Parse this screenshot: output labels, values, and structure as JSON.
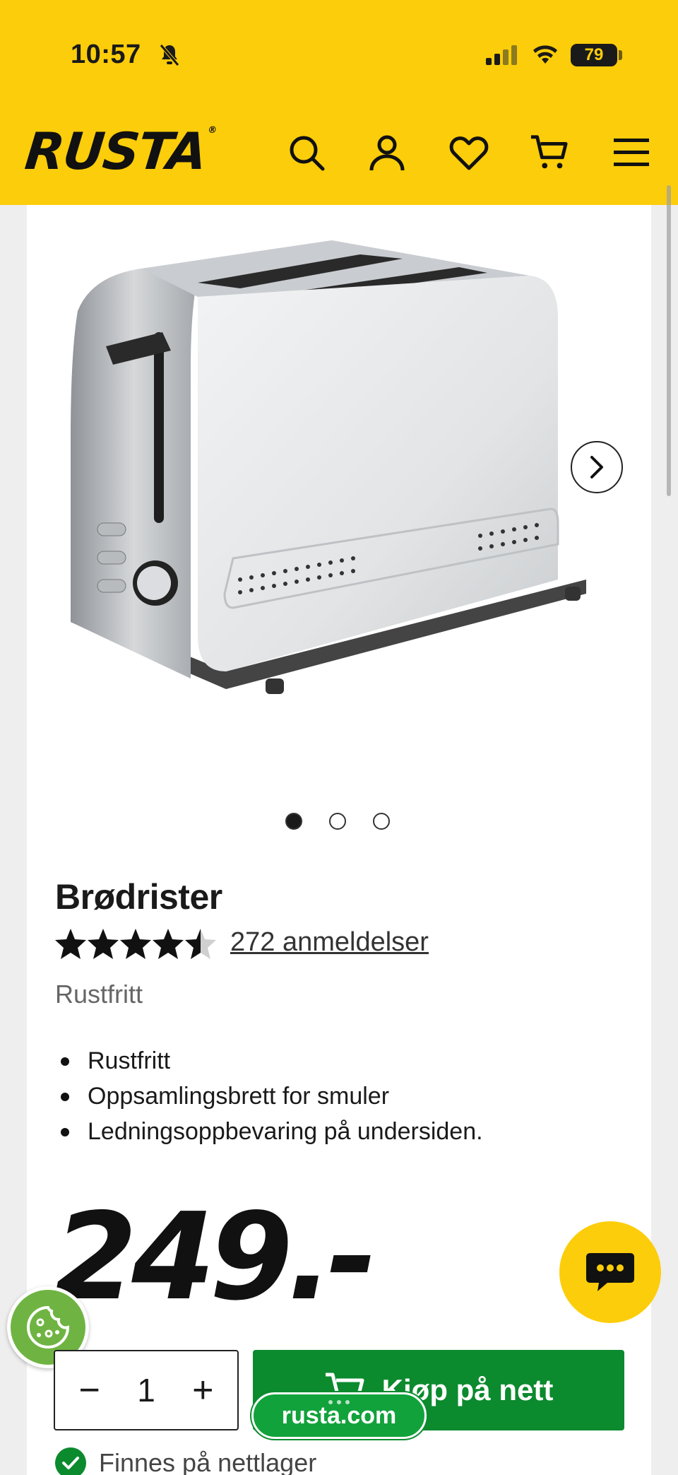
{
  "status_bar": {
    "time": "10:57",
    "battery": "79"
  },
  "header": {
    "logo": "RUSTA",
    "icons": [
      "search-icon",
      "account-icon",
      "heart-icon",
      "cart-icon",
      "menu-icon"
    ],
    "brand_color": "#fccd0a"
  },
  "gallery": {
    "slide_count": 3,
    "active_slide": 1
  },
  "product": {
    "title": "Brødrister",
    "rating": 4.5,
    "reviews": "272 anmeldelser",
    "subtitle": "Rustfritt",
    "features": [
      "Rustfritt",
      "Oppsamlingsbrett for smuler",
      "Ledningsoppbevaring på undersiden."
    ],
    "price": "249.-"
  },
  "purchase": {
    "quantity": "1",
    "minus": "−",
    "plus": "+",
    "buy_label": "Kjøp på nett",
    "buy_color": "#0c8a2e",
    "stock": "Finnes på nettlager"
  },
  "browser": {
    "url": "rusta.com"
  }
}
